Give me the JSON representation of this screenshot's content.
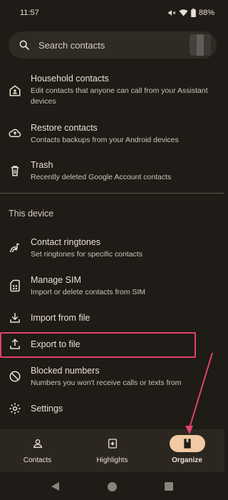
{
  "status": {
    "time": "11:57",
    "battery": "88%"
  },
  "search": {
    "placeholder": "Search contacts"
  },
  "items_top": [
    {
      "title": "Household contacts",
      "subtitle": "Edit contacts that anyone can call from your Assistant devices",
      "icon": "household-icon"
    },
    {
      "title": "Restore contacts",
      "subtitle": "Contacts backups from your Android devices",
      "icon": "cloud-restore-icon"
    },
    {
      "title": "Trash",
      "subtitle": "Recently deleted Google Account contacts",
      "icon": "trash-icon"
    }
  ],
  "section": {
    "title": "This device"
  },
  "items_device": [
    {
      "title": "Contact ringtones",
      "subtitle": "Set ringtones for specific contacts",
      "icon": "ringtone-icon"
    },
    {
      "title": "Manage SIM",
      "subtitle": "Import or delete contacts from SIM",
      "icon": "sim-icon"
    },
    {
      "title": "Import from file",
      "icon": "import-icon"
    },
    {
      "title": "Export to file",
      "icon": "export-icon"
    },
    {
      "title": "Blocked numbers",
      "subtitle": "Numbers you won't receive calls or texts from",
      "icon": "block-icon"
    },
    {
      "title": "Settings",
      "icon": "settings-icon"
    }
  ],
  "nav": [
    {
      "label": "Contacts",
      "icon": "person-icon"
    },
    {
      "label": "Highlights",
      "icon": "highlights-icon"
    },
    {
      "label": "Organize",
      "icon": "organize-icon",
      "active": true
    }
  ],
  "colors": {
    "accent_pill": "#f1c9a4",
    "highlight": "#e0426a",
    "background": "#1f1b16"
  }
}
